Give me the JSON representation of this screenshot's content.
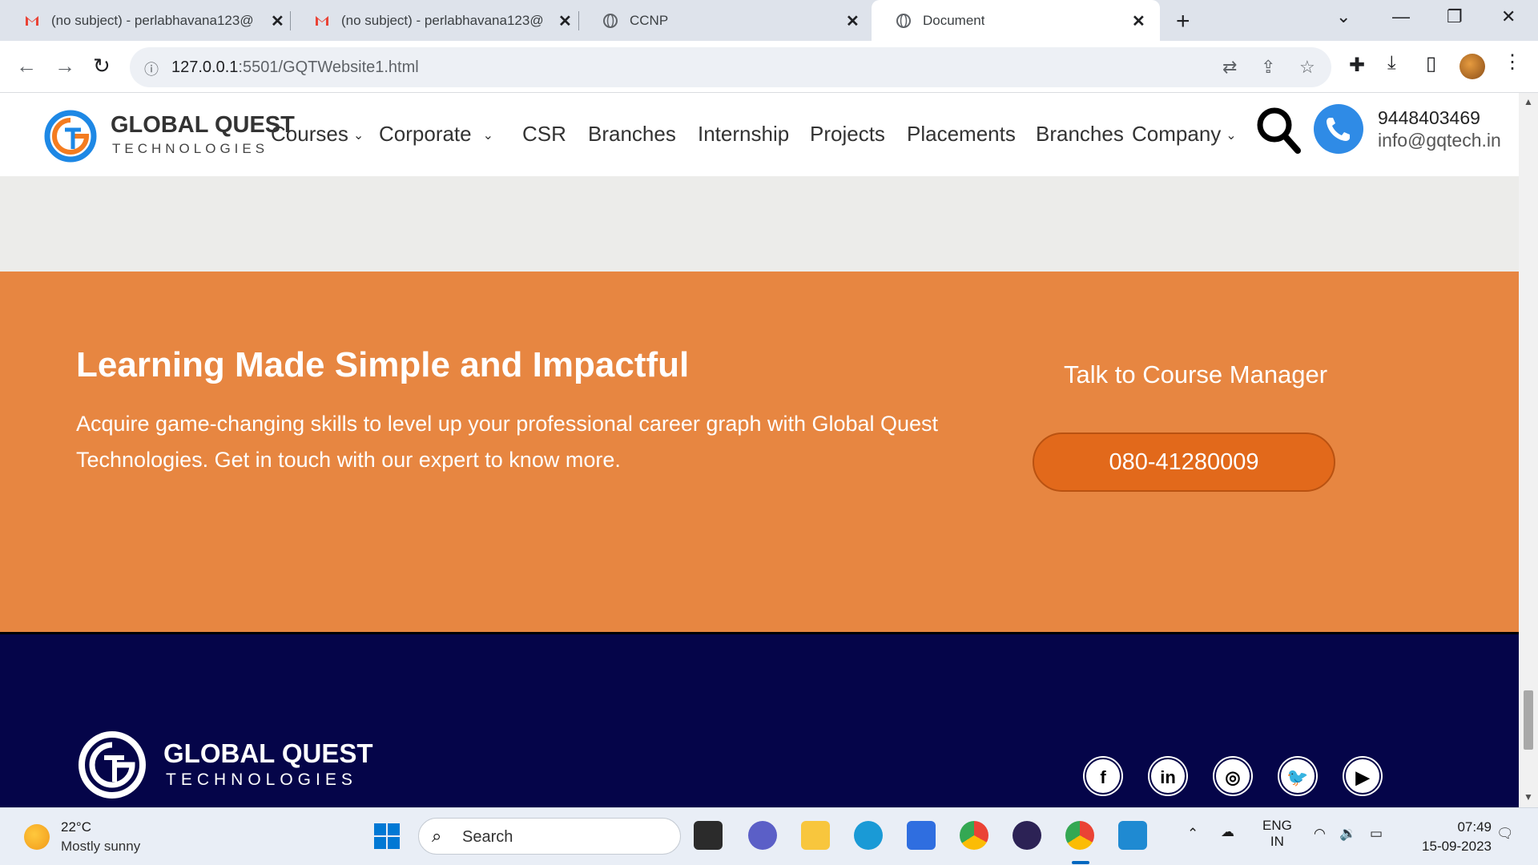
{
  "browser": {
    "tabs": [
      {
        "title": "(no subject) - perlabhavana123@",
        "close": "✕"
      },
      {
        "title": "(no subject) - perlabhavana123@",
        "close": "✕"
      },
      {
        "title": "CCNP",
        "close": "✕"
      },
      {
        "title": "Document",
        "close": "✕"
      }
    ],
    "new_tab": "+",
    "url_host": "127.0.0.1",
    "url_path": ":5501/GQTWebsite1.html"
  },
  "site": {
    "logo_name": "GLOBAL QUEST",
    "logo_sub": "TECHNOLOGIES",
    "menu": [
      "Courses",
      "Corporate",
      "CSR",
      "Branches",
      "Internship",
      "Projects",
      "Placements",
      "Branches",
      "Company"
    ],
    "phone": "9448403469",
    "email": "info@gqtech.in"
  },
  "cta": {
    "title": "Learning Made Simple and Impactful",
    "desc": "Acquire game-changing skills to level up your professional career graph with Global Quest Technologies. Get in touch with our expert to know more.",
    "talk": "Talk to Course Manager",
    "button": "080-41280009"
  },
  "footer": {
    "logo_name": "GLOBAL QUEST",
    "logo_sub": "TECHNOLOGIES",
    "socials": [
      "facebook-icon",
      "linkedin-icon",
      "instagram-icon",
      "twitter-icon",
      "youtube-icon"
    ]
  },
  "taskbar": {
    "temp": "22°C",
    "weather": "Mostly sunny",
    "search": "Search",
    "lang1": "ENG",
    "lang2": "IN",
    "time": "07:49",
    "date": "15-09-2023"
  },
  "colors": {
    "brand_orange": "#e78641",
    "button_orange": "#e2691b",
    "footer_navy": "#050549",
    "phone_blue": "#2f8be6"
  }
}
